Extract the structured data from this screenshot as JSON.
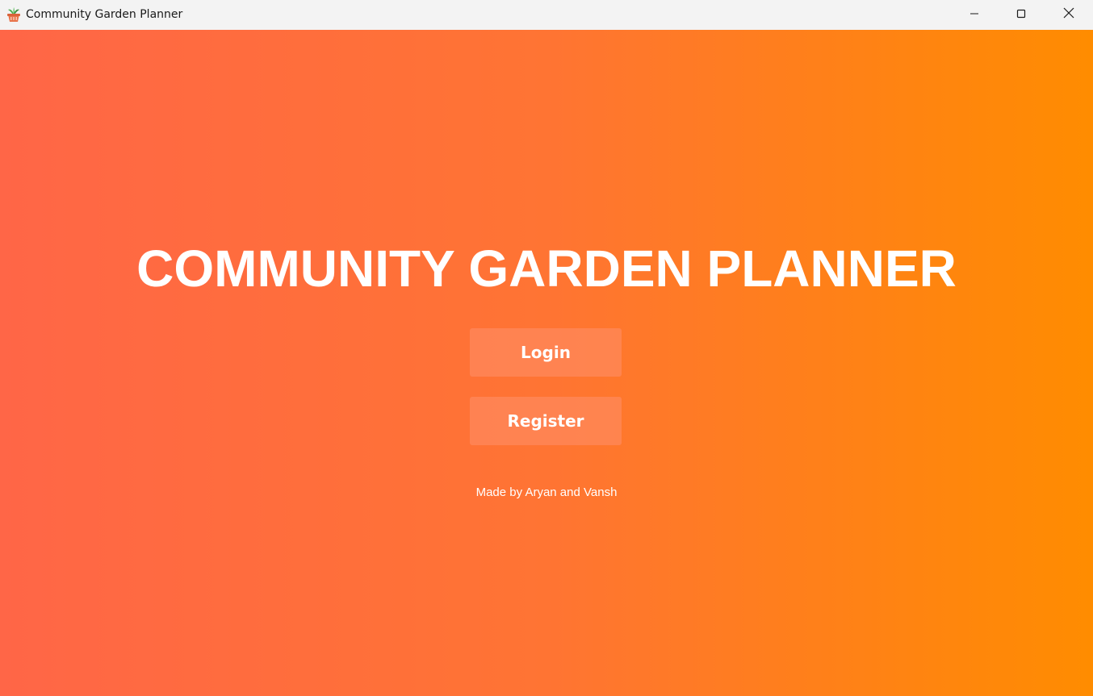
{
  "window": {
    "title": "Community Garden Planner",
    "app_icon": "potted-plant-icon",
    "controls": {
      "minimize_icon": "minimize-icon",
      "maximize_icon": "maximize-icon",
      "close_icon": "close-icon"
    }
  },
  "main": {
    "heading": "COMMUNITY GARDEN PLANNER",
    "login_label": "Login",
    "register_label": "Register",
    "credits": "Made by Aryan and Vansh"
  },
  "colors": {
    "gradient_start": "#ff6647",
    "gradient_end": "#ff8c00",
    "button_bg": "#ff7f57",
    "text": "#ffffff"
  }
}
